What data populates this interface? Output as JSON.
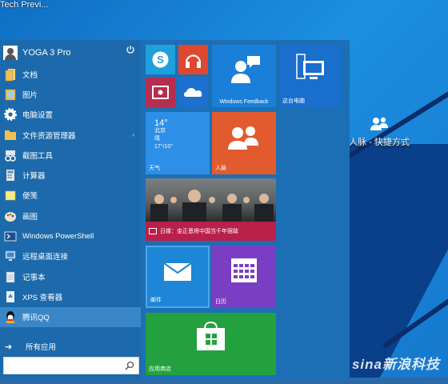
{
  "desktop": {
    "top_title": "Tech Previ...",
    "shortcut_label": "人脉 - 快捷方式",
    "watermark": "sina新浪科技"
  },
  "start_menu": {
    "user": "YOGA 3 Pro",
    "items": [
      {
        "label": "文档",
        "icon": "documents-icon"
      },
      {
        "label": "图片",
        "icon": "pictures-icon"
      },
      {
        "label": "电脑设置",
        "icon": "gear-icon"
      },
      {
        "label": "文件资源管理器",
        "icon": "file-explorer-icon",
        "has_arrow": true
      },
      {
        "label": "截图工具",
        "icon": "snipping-tool-icon"
      },
      {
        "label": "计算器",
        "icon": "calculator-icon"
      },
      {
        "label": "便笺",
        "icon": "sticky-notes-icon"
      },
      {
        "label": "画图",
        "icon": "paint-icon"
      },
      {
        "label": "Windows PowerShell",
        "icon": "powershell-icon"
      },
      {
        "label": "远程桌面连接",
        "icon": "remote-desktop-icon"
      },
      {
        "label": "记事本",
        "icon": "notepad-icon"
      },
      {
        "label": "XPS 查看器",
        "icon": "xps-viewer-icon"
      },
      {
        "label": "腾讯QQ",
        "icon": "qq-icon",
        "highlighted": true
      }
    ],
    "all_apps": "所有应用",
    "search_placeholder": ""
  },
  "tiles": {
    "skype": {
      "color": "#1ea1db"
    },
    "music": {
      "color": "#e0472f"
    },
    "video": {
      "color": "#b62d4f"
    },
    "onedrive": {
      "color": "#1d6fd0"
    },
    "feedback": {
      "label": "Windows Feedback",
      "color": "#1a7fd8"
    },
    "this_pc": {
      "label": "这台电脑",
      "color": "#1a6ecc"
    },
    "weather": {
      "temp": "14°",
      "city": "北京",
      "condition": "晴",
      "range": "17°/10°",
      "label": "天气",
      "color": "#2d8fe6"
    },
    "people": {
      "label": "人脉",
      "color": "#e25b2f"
    },
    "news": {
      "headline": "日媒：金正恩将中国当千年宿敌",
      "color": "#b9204a"
    },
    "mail": {
      "label": "邮件",
      "color": "#1e86d6"
    },
    "calendar": {
      "label": "日历",
      "color": "#7a3ec4"
    },
    "store": {
      "label": "应用商店",
      "color": "#24a13f"
    }
  }
}
